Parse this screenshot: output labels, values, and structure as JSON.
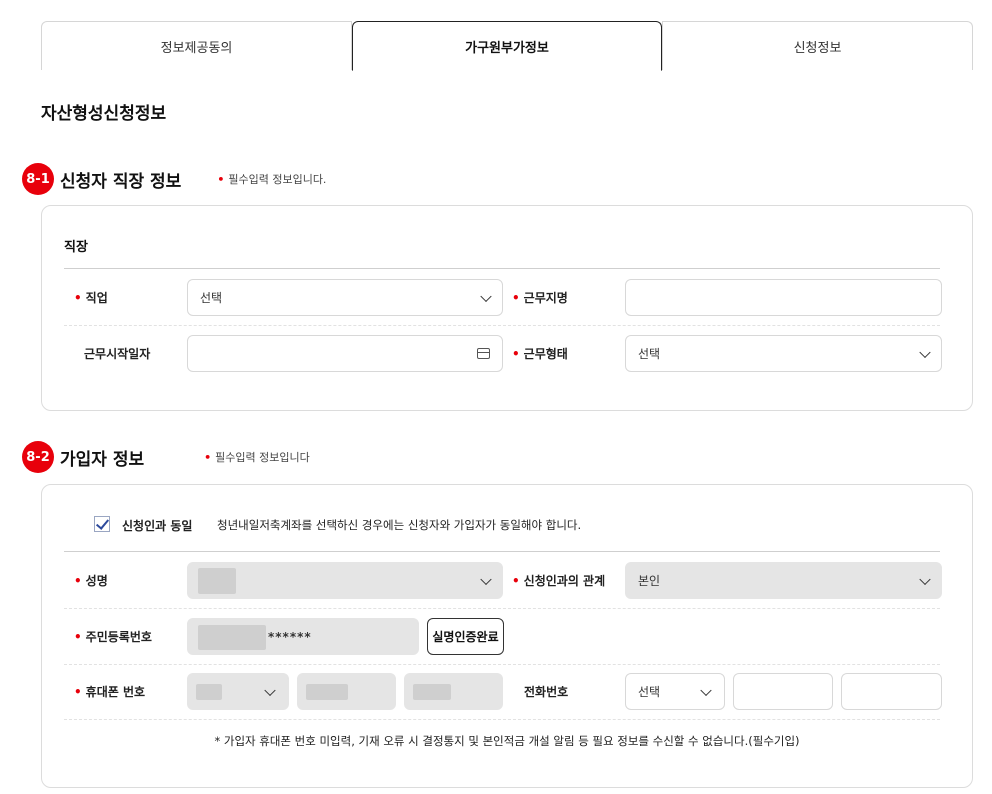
{
  "tabs": [
    {
      "label": "정보제공동의",
      "active": false
    },
    {
      "label": "가구원부가정보",
      "active": true
    },
    {
      "label": "신청정보",
      "active": false
    }
  ],
  "page_title": "자산형성신청정보",
  "section1": {
    "badge": "8-1",
    "title": "신청자 직장 정보",
    "required_note": "필수입력 정보입니다.",
    "group_title": "직장",
    "job": {
      "label": "직업",
      "value": "선택",
      "required": true
    },
    "workplace_name": {
      "label": "근무지명",
      "value": "",
      "required": true
    },
    "start_date": {
      "label": "근무시작일자",
      "value": "",
      "required": false
    },
    "work_type": {
      "label": "근무형태",
      "value": "선택",
      "required": true
    }
  },
  "section2": {
    "badge": "8-2",
    "title": "가입자 정보",
    "required_note": "필수입력 정보입니다",
    "same_as_applicant": {
      "label": "신청인과 동일",
      "checked": true,
      "note": "청년내일저축계좌를 선택하신 경우에는 신청자와 가입자가 동일해야 합니다."
    },
    "name": {
      "label": "성명",
      "value": ""
    },
    "relation": {
      "label": "신청인과의 관계",
      "value": "본인"
    },
    "resident_no": {
      "label": "주민등록번호",
      "masked_suffix": "******"
    },
    "verify_button": "실명인증완료",
    "mobile": {
      "label": "휴대폰 번호"
    },
    "phone": {
      "label": "전화번호",
      "area_value": "선택"
    },
    "footnote": "* 가입자 휴대폰 번호 미입력, 기재 오류 시 결정통지 및 본인적금 개설 알림 등 필요 정보를 수신할 수 없습니다.(필수기입)"
  },
  "colors": {
    "accent_red": "#e8000b",
    "check_blue": "#2d4a9c"
  }
}
